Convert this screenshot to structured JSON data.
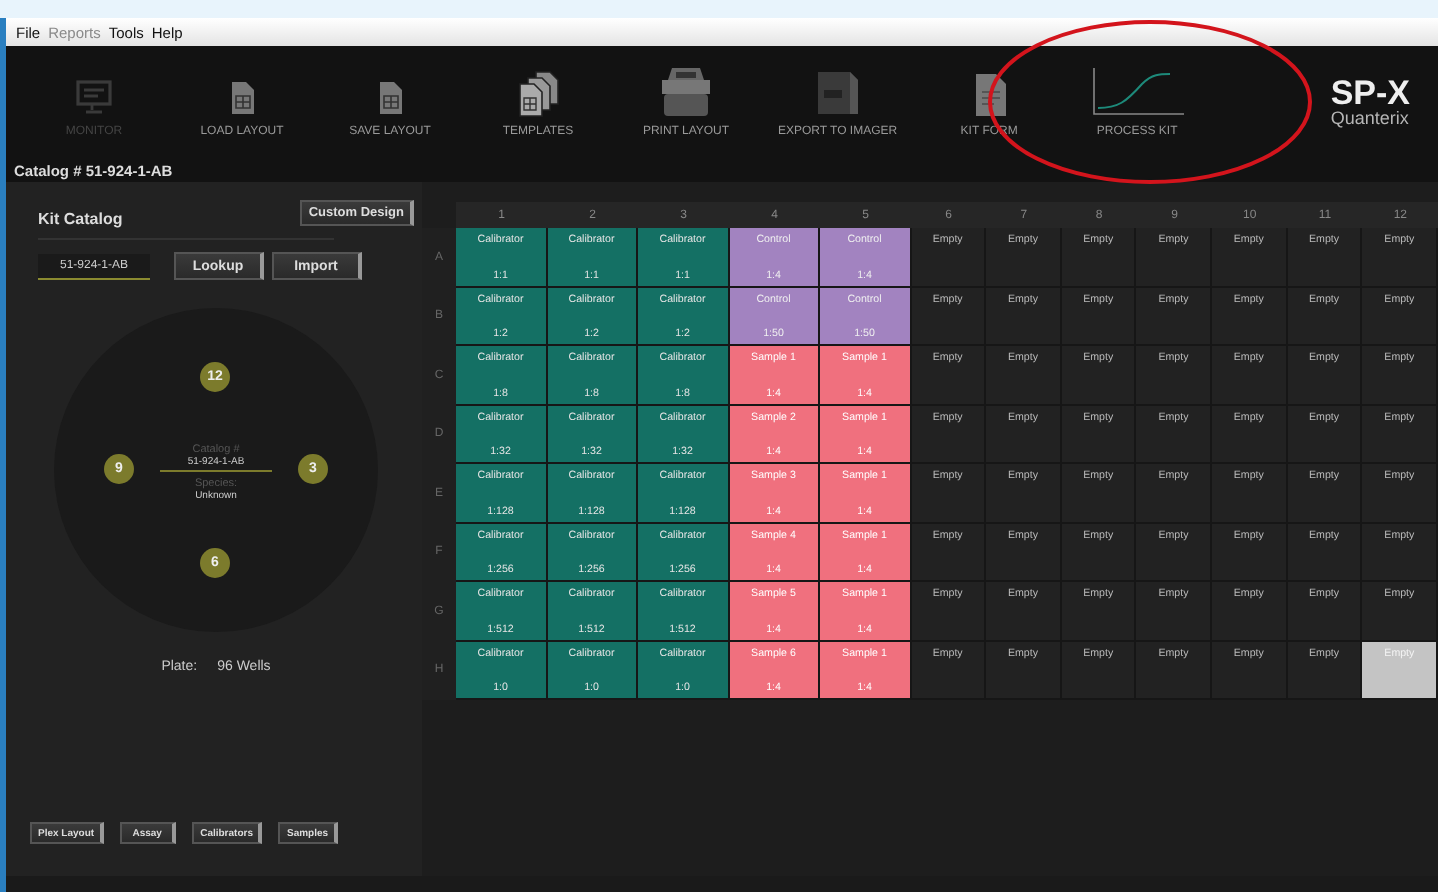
{
  "menu": [
    {
      "label": "File",
      "disabled": false
    },
    {
      "label": "Reports",
      "disabled": true
    },
    {
      "label": "Tools",
      "disabled": false
    },
    {
      "label": "Help",
      "disabled": false
    }
  ],
  "toolbar": [
    {
      "label": "MONITOR",
      "disabled": true
    },
    {
      "label": "LOAD LAYOUT",
      "disabled": false
    },
    {
      "label": "SAVE LAYOUT",
      "disabled": false
    },
    {
      "label": "TEMPLATES",
      "disabled": false
    },
    {
      "label": "PRINT LAYOUT",
      "disabled": false
    },
    {
      "label": "EXPORT TO IMAGER",
      "disabled": false
    },
    {
      "label": "KIT FORM",
      "disabled": false
    },
    {
      "label": "PROCESS KIT",
      "disabled": false
    }
  ],
  "logo": {
    "name": "SP-X",
    "company": "Quanterix"
  },
  "catalog_title": "Catalog # 51-924-1-AB",
  "kit_catalog": {
    "title": "Kit Catalog",
    "custom_button": "Custom Design",
    "field_value": "51-924-1-AB",
    "buttons": [
      "Lookup",
      "Import"
    ],
    "dial": {
      "catalog_label": "Catalog #",
      "catalog_value": "51-924-1-AB",
      "species_label": "Species:",
      "species_value": "Unknown",
      "markers": [
        {
          "label": "12"
        },
        {
          "label": "3"
        },
        {
          "label": "6"
        },
        {
          "label": "9"
        }
      ]
    },
    "plate_label": "Plate:",
    "plate_value": "96 Wells",
    "bottom_buttons": [
      "Plex Layout",
      "Assay",
      "Calibrators",
      "Samples"
    ]
  },
  "plate": {
    "columns": [
      "1",
      "2",
      "3",
      "4",
      "5",
      "6",
      "7",
      "8",
      "9",
      "10",
      "11",
      "12"
    ],
    "rows": [
      {
        "letter": "A",
        "cells": [
          {
            "kind": "calibrator",
            "label": "Calibrator",
            "ratio": "1:1",
            "selected": false
          },
          {
            "kind": "calibrator",
            "label": "Calibrator",
            "ratio": "1:1",
            "selected": false
          },
          {
            "kind": "calibrator",
            "label": "Calibrator",
            "ratio": "1:1",
            "selected": false
          },
          {
            "kind": "control",
            "label": "Control",
            "ratio": "1:4",
            "selected": false
          },
          {
            "kind": "control",
            "label": "Control",
            "ratio": "1:4",
            "selected": false
          },
          {
            "kind": "empty",
            "label": "Empty",
            "selected": false
          },
          {
            "kind": "empty",
            "label": "Empty",
            "selected": false
          },
          {
            "kind": "empty",
            "label": "Empty",
            "selected": false
          },
          {
            "kind": "empty",
            "label": "Empty",
            "selected": false
          },
          {
            "kind": "empty",
            "label": "Empty",
            "selected": false
          },
          {
            "kind": "empty",
            "label": "Empty",
            "selected": false
          },
          {
            "kind": "empty",
            "label": "Empty",
            "selected": false
          }
        ]
      },
      {
        "letter": "B",
        "cells": [
          {
            "kind": "calibrator",
            "label": "Calibrator",
            "ratio": "1:2",
            "selected": false
          },
          {
            "kind": "calibrator",
            "label": "Calibrator",
            "ratio": "1:2",
            "selected": false
          },
          {
            "kind": "calibrator",
            "label": "Calibrator",
            "ratio": "1:2",
            "selected": false
          },
          {
            "kind": "control",
            "label": "Control",
            "ratio": "1:50",
            "selected": false
          },
          {
            "kind": "control",
            "label": "Control",
            "ratio": "1:50",
            "selected": false
          },
          {
            "kind": "empty",
            "label": "Empty",
            "selected": false
          },
          {
            "kind": "empty",
            "label": "Empty",
            "selected": false
          },
          {
            "kind": "empty",
            "label": "Empty",
            "selected": false
          },
          {
            "kind": "empty",
            "label": "Empty",
            "selected": false
          },
          {
            "kind": "empty",
            "label": "Empty",
            "selected": false
          },
          {
            "kind": "empty",
            "label": "Empty",
            "selected": false
          },
          {
            "kind": "empty",
            "label": "Empty",
            "selected": false
          }
        ]
      },
      {
        "letter": "C",
        "cells": [
          {
            "kind": "calibrator",
            "label": "Calibrator",
            "ratio": "1:8",
            "selected": false
          },
          {
            "kind": "calibrator",
            "label": "Calibrator",
            "ratio": "1:8",
            "selected": false
          },
          {
            "kind": "calibrator",
            "label": "Calibrator",
            "ratio": "1:8",
            "selected": false
          },
          {
            "kind": "sample",
            "label": "Sample 1",
            "ratio": "1:4",
            "selected": false
          },
          {
            "kind": "sample",
            "label": "Sample 1",
            "ratio": "1:4",
            "selected": false
          },
          {
            "kind": "empty",
            "label": "Empty",
            "selected": false
          },
          {
            "kind": "empty",
            "label": "Empty",
            "selected": false
          },
          {
            "kind": "empty",
            "label": "Empty",
            "selected": false
          },
          {
            "kind": "empty",
            "label": "Empty",
            "selected": false
          },
          {
            "kind": "empty",
            "label": "Empty",
            "selected": false
          },
          {
            "kind": "empty",
            "label": "Empty",
            "selected": false
          },
          {
            "kind": "empty",
            "label": "Empty",
            "selected": false
          }
        ]
      },
      {
        "letter": "D",
        "cells": [
          {
            "kind": "calibrator",
            "label": "Calibrator",
            "ratio": "1:32",
            "selected": false
          },
          {
            "kind": "calibrator",
            "label": "Calibrator",
            "ratio": "1:32",
            "selected": false
          },
          {
            "kind": "calibrator",
            "label": "Calibrator",
            "ratio": "1:32",
            "selected": false
          },
          {
            "kind": "sample",
            "label": "Sample 2",
            "ratio": "1:4",
            "selected": false
          },
          {
            "kind": "sample",
            "label": "Sample 1",
            "ratio": "1:4",
            "selected": false
          },
          {
            "kind": "empty",
            "label": "Empty",
            "selected": false
          },
          {
            "kind": "empty",
            "label": "Empty",
            "selected": false
          },
          {
            "kind": "empty",
            "label": "Empty",
            "selected": false
          },
          {
            "kind": "empty",
            "label": "Empty",
            "selected": false
          },
          {
            "kind": "empty",
            "label": "Empty",
            "selected": false
          },
          {
            "kind": "empty",
            "label": "Empty",
            "selected": false
          },
          {
            "kind": "empty",
            "label": "Empty",
            "selected": false
          }
        ]
      },
      {
        "letter": "E",
        "cells": [
          {
            "kind": "calibrator",
            "label": "Calibrator",
            "ratio": "1:128",
            "selected": false
          },
          {
            "kind": "calibrator",
            "label": "Calibrator",
            "ratio": "1:128",
            "selected": false
          },
          {
            "kind": "calibrator",
            "label": "Calibrator",
            "ratio": "1:128",
            "selected": false
          },
          {
            "kind": "sample",
            "label": "Sample 3",
            "ratio": "1:4",
            "selected": false
          },
          {
            "kind": "sample",
            "label": "Sample 1",
            "ratio": "1:4",
            "selected": false
          },
          {
            "kind": "empty",
            "label": "Empty",
            "selected": false
          },
          {
            "kind": "empty",
            "label": "Empty",
            "selected": false
          },
          {
            "kind": "empty",
            "label": "Empty",
            "selected": false
          },
          {
            "kind": "empty",
            "label": "Empty",
            "selected": false
          },
          {
            "kind": "empty",
            "label": "Empty",
            "selected": false
          },
          {
            "kind": "empty",
            "label": "Empty",
            "selected": false
          },
          {
            "kind": "empty",
            "label": "Empty",
            "selected": false
          }
        ]
      },
      {
        "letter": "F",
        "cells": [
          {
            "kind": "calibrator",
            "label": "Calibrator",
            "ratio": "1:256",
            "selected": false
          },
          {
            "kind": "calibrator",
            "label": "Calibrator",
            "ratio": "1:256",
            "selected": false
          },
          {
            "kind": "calibrator",
            "label": "Calibrator",
            "ratio": "1:256",
            "selected": false
          },
          {
            "kind": "sample",
            "label": "Sample 4",
            "ratio": "1:4",
            "selected": false
          },
          {
            "kind": "sample",
            "label": "Sample 1",
            "ratio": "1:4",
            "selected": false
          },
          {
            "kind": "empty",
            "label": "Empty",
            "selected": false
          },
          {
            "kind": "empty",
            "label": "Empty",
            "selected": false
          },
          {
            "kind": "empty",
            "label": "Empty",
            "selected": false
          },
          {
            "kind": "empty",
            "label": "Empty",
            "selected": false
          },
          {
            "kind": "empty",
            "label": "Empty",
            "selected": false
          },
          {
            "kind": "empty",
            "label": "Empty",
            "selected": false
          },
          {
            "kind": "empty",
            "label": "Empty",
            "selected": false
          }
        ]
      },
      {
        "letter": "G",
        "cells": [
          {
            "kind": "calibrator",
            "label": "Calibrator",
            "ratio": "1:512",
            "selected": false
          },
          {
            "kind": "calibrator",
            "label": "Calibrator",
            "ratio": "1:512",
            "selected": false
          },
          {
            "kind": "calibrator",
            "label": "Calibrator",
            "ratio": "1:512",
            "selected": false
          },
          {
            "kind": "sample",
            "label": "Sample 5",
            "ratio": "1:4",
            "selected": false
          },
          {
            "kind": "sample",
            "label": "Sample 1",
            "ratio": "1:4",
            "selected": false
          },
          {
            "kind": "empty",
            "label": "Empty",
            "selected": false
          },
          {
            "kind": "empty",
            "label": "Empty",
            "selected": false
          },
          {
            "kind": "empty",
            "label": "Empty",
            "selected": false
          },
          {
            "kind": "empty",
            "label": "Empty",
            "selected": false
          },
          {
            "kind": "empty",
            "label": "Empty",
            "selected": false
          },
          {
            "kind": "empty",
            "label": "Empty",
            "selected": false
          },
          {
            "kind": "empty",
            "label": "Empty",
            "selected": false
          }
        ]
      },
      {
        "letter": "H",
        "cells": [
          {
            "kind": "calibrator",
            "label": "Calibrator",
            "ratio": "1:0",
            "selected": false
          },
          {
            "kind": "calibrator",
            "label": "Calibrator",
            "ratio": "1:0",
            "selected": false
          },
          {
            "kind": "calibrator",
            "label": "Calibrator",
            "ratio": "1:0",
            "selected": false
          },
          {
            "kind": "sample",
            "label": "Sample 6",
            "ratio": "1:4",
            "selected": false
          },
          {
            "kind": "sample",
            "label": "Sample 1",
            "ratio": "1:4",
            "selected": false
          },
          {
            "kind": "empty",
            "label": "Empty",
            "selected": false
          },
          {
            "kind": "empty",
            "label": "Empty",
            "selected": false
          },
          {
            "kind": "empty",
            "label": "Empty",
            "selected": false
          },
          {
            "kind": "empty",
            "label": "Empty",
            "selected": false
          },
          {
            "kind": "empty",
            "label": "Empty",
            "selected": false
          },
          {
            "kind": "empty",
            "label": "Empty",
            "selected": false
          },
          {
            "kind": "empty",
            "label": "Empty",
            "selected": true
          }
        ]
      }
    ]
  }
}
